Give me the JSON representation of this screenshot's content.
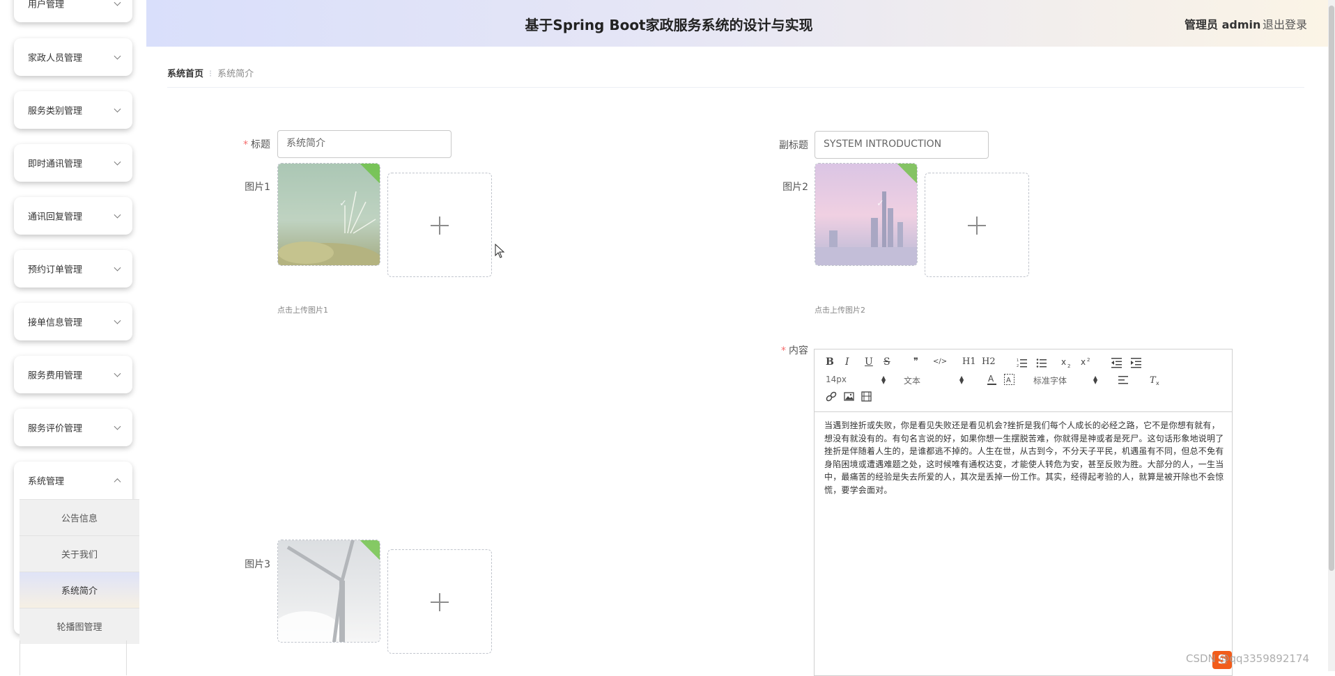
{
  "header": {
    "title": "基于Spring Boot家政服务系统的设计与实现",
    "user": "管理员 admin",
    "logout": "退出登录"
  },
  "sidebar": {
    "items": [
      {
        "label": "用户管理"
      },
      {
        "label": "家政人员管理"
      },
      {
        "label": "服务类别管理"
      },
      {
        "label": "即时通讯管理"
      },
      {
        "label": "通讯回复管理"
      },
      {
        "label": "预约订单管理"
      },
      {
        "label": "接单信息管理"
      },
      {
        "label": "服务费用管理"
      },
      {
        "label": "服务评价管理"
      },
      {
        "label": "系统管理"
      }
    ],
    "submenu": [
      {
        "label": "公告信息"
      },
      {
        "label": "关于我们"
      },
      {
        "label": "系统简介"
      },
      {
        "label": "轮播图管理"
      }
    ],
    "active_submenu": "系统简介"
  },
  "breadcrumb": {
    "home": "系统首页",
    "separator": "⁝",
    "current": "系统简介"
  },
  "form": {
    "title_label": "标题",
    "title_value": "系统简介",
    "subtitle_label": "副标题",
    "subtitle_value": "SYSTEM INTRODUCTION",
    "image1_label": "图片1",
    "image1_tip": "点击上传图片1",
    "image2_label": "图片2",
    "image2_tip": "点击上传图片2",
    "image3_label": "图片3",
    "content_label": "内容",
    "required_mark": "*",
    "plus": "+"
  },
  "editor": {
    "toolbar": {
      "bold": "B",
      "italic": "I",
      "underline": "U",
      "strike": "S",
      "quote": "❞",
      "code": "</>",
      "h1": "H1",
      "h2": "H2",
      "font_size": "14px",
      "header_select": "文本",
      "font_family": "标准字体"
    },
    "content": "当遇到挫折或失败，你是看见失败还是看见机会?挫折是我们每个人成长的必经之路，它不是你想有就有，想没有就没有的。有句名言说的好，如果你想一生摆脱苦难，你就得是神或者是死尸。这句话形象地说明了挫折是伴随着人生的，是谁都逃不掉的。人生在世，从古到今，不分天子平民，机遇虽有不同，但总不免有身陷困境或遭遇难题之处，这时候唯有通权达变，才能使人转危为安，甚至反败为胜。大部分的人，一生当中，最痛苦的经验是失去所爱的人，其次是丢掉一份工作。其实，经得起考验的人，就算是被开除也不会惊慌，要学会面对。"
  },
  "watermark": "CSDN @qq3359892174",
  "colors": {
    "required": "#f56c6c",
    "success_corner": "#67c23a",
    "header_left": "#d9dffb",
    "header_right": "#fbf4e6"
  }
}
